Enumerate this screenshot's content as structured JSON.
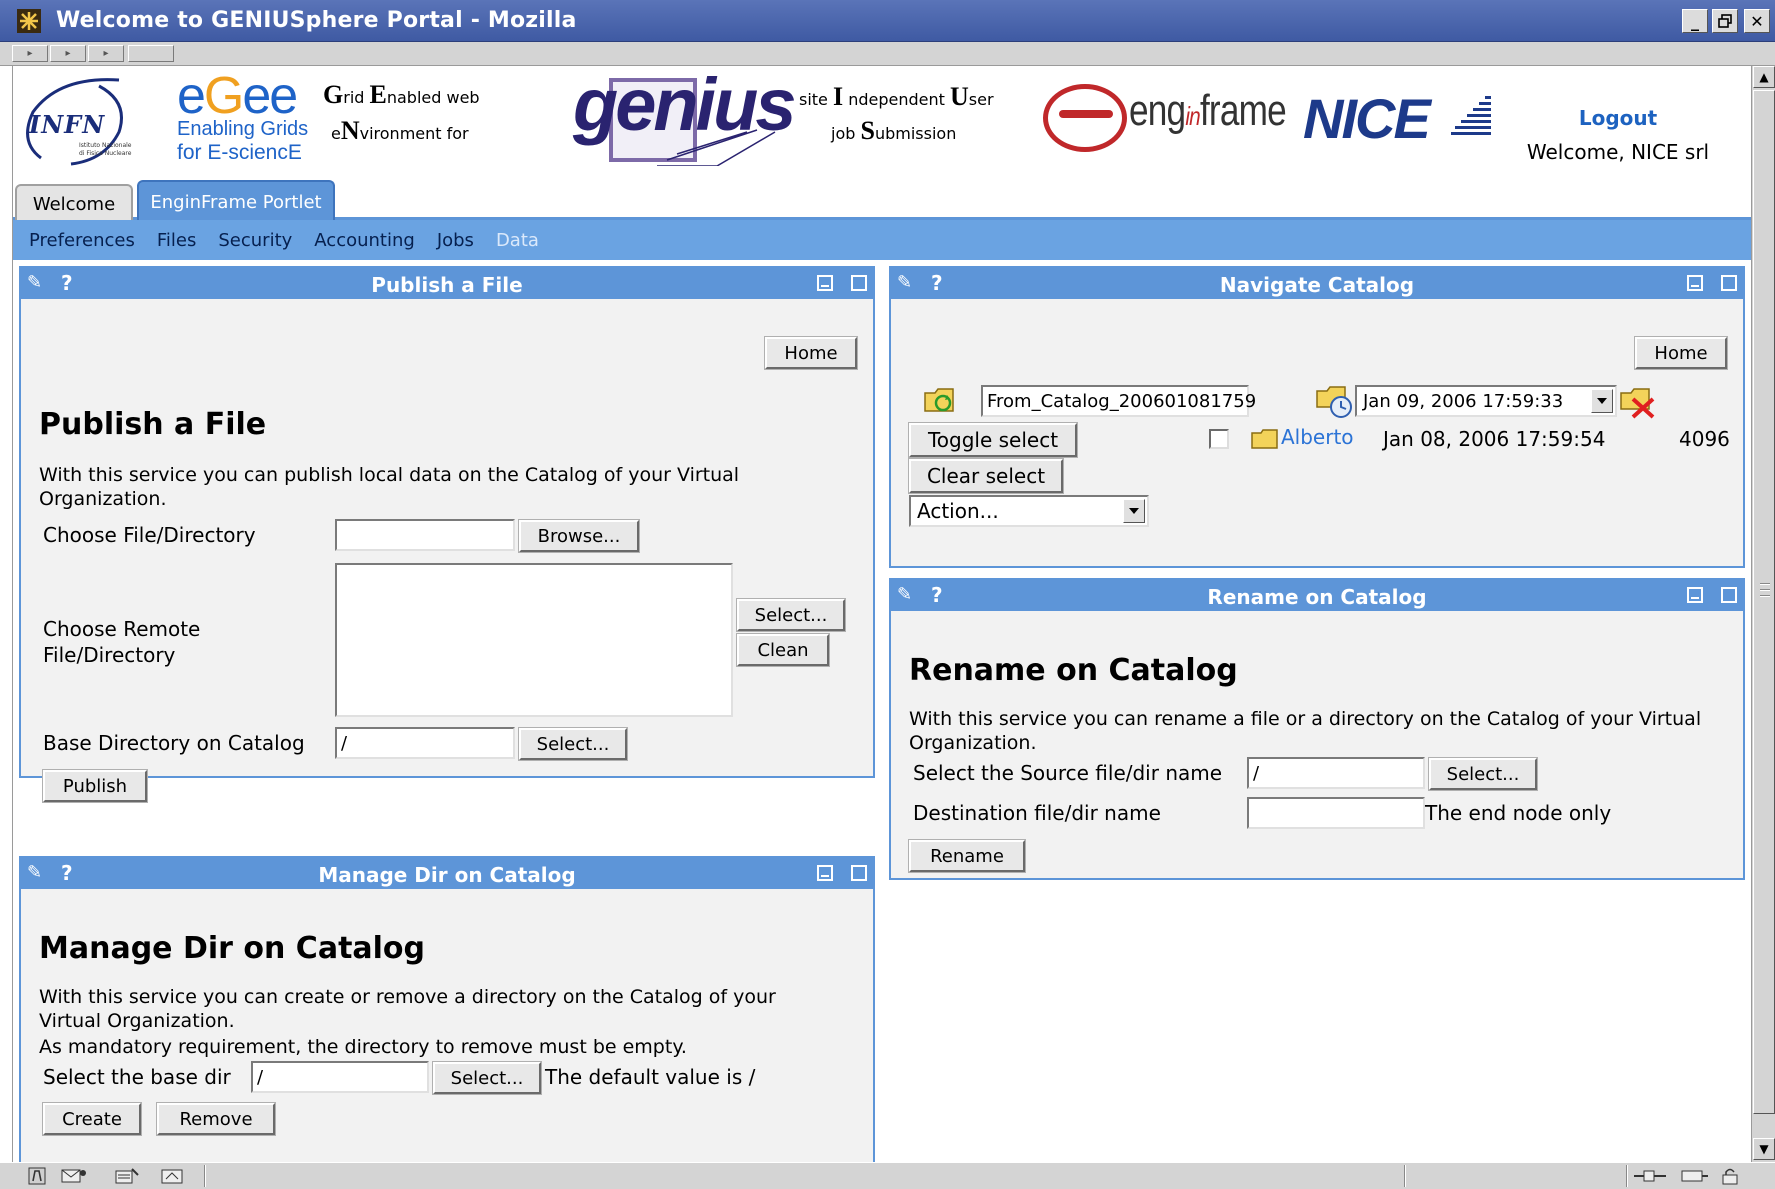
{
  "window": {
    "title": "Welcome to GENIUSphere Portal - Mozilla",
    "controls": {
      "minimize": "_",
      "restore": "▫",
      "close": "✕"
    }
  },
  "header": {
    "infn": {
      "name": "INFN",
      "line1": "Istituto Nazionale",
      "line2": "di Fisica Nucleare"
    },
    "egee": {
      "logo": "egee",
      "line1": "Enabling Grids",
      "line2": "for E-sciencE"
    },
    "genius_tagline_left": {
      "w1_big": "G",
      "w1": "rid ",
      "w2_big": "E",
      "w2": "nabled web",
      "w3": "e",
      "w3_big": "N",
      "w4": "vironment for"
    },
    "genius_logo": "genius",
    "genius_tagline_right": {
      "w1": "site ",
      "w2_big": "I",
      "w2": " ndependent ",
      "w3_big": "U",
      "w3": "ser",
      "w4": "job ",
      "w5_big": "S",
      "w5": "ubmission"
    },
    "enginframe_logo": {
      "a": "eng",
      "b": "in",
      "c": "frame"
    },
    "nice_logo": "NICE",
    "logout": "Logout",
    "welcome": "Welcome, NICE srl"
  },
  "tabs": [
    {
      "label": "Welcome"
    },
    {
      "label": "EnginFrame Portlet"
    }
  ],
  "subnav": [
    {
      "label": "Preferences"
    },
    {
      "label": "Files"
    },
    {
      "label": "Security"
    },
    {
      "label": "Accounting"
    },
    {
      "label": "Jobs"
    },
    {
      "label": "Data"
    }
  ],
  "publish": {
    "header": "Publish a File",
    "help": "?",
    "home": "Home",
    "title": "Publish a File",
    "description": "With this service you can publish local data on the Catalog of your Virtual Organization.",
    "choose_file_label": "Choose File/Directory",
    "browse": "Browse...",
    "choose_remote_label_1": "Choose Remote",
    "choose_remote_label_2": "File/Directory",
    "select": "Select...",
    "clean": "Clean",
    "base_dir_label": "Base Directory on Catalog",
    "base_dir_value": "/",
    "base_select": "Select...",
    "publish": "Publish"
  },
  "manage": {
    "header": "Manage Dir on Catalog",
    "help": "?",
    "title": "Manage Dir on Catalog",
    "description_1": "With this service you can create or remove a directory on the Catalog of your Virtual Organization.",
    "description_2": "As mandatory requirement, the directory to remove must be empty.",
    "base_dir_label": "Select the base dir",
    "base_dir_value": "/",
    "select": "Select...",
    "default_note": "The default value is /",
    "create": "Create",
    "remove": "Remove"
  },
  "navigate": {
    "header": "Navigate Catalog",
    "help": "?",
    "home": "Home",
    "catalog_name": "From_Catalog_200601081759",
    "date_value": "Jan 09, 2006 17:59:33",
    "toggle_select": "Toggle select",
    "clear_select": "Clear select",
    "action": "Action...",
    "row": {
      "name": "Alberto",
      "date": "Jan 08, 2006 17:59:54",
      "size": "4096"
    }
  },
  "rename": {
    "header": "Rename on Catalog",
    "help": "?",
    "title": "Rename on Catalog",
    "description": "With this service you can rename a file or a directory on the Catalog of your Virtual Organization.",
    "source_label": "Select the Source file/dir name",
    "source_value": "/",
    "select": "Select...",
    "dest_label": "Destination file/dir name",
    "dest_value": "",
    "dest_note": "The end node only",
    "rename": "Rename"
  },
  "statusbar": {
    "icons": [
      "mozilla-icon",
      "mail-icon",
      "composer-icon",
      "addressbook-icon"
    ]
  },
  "colors": {
    "portlet_header": "#5d95d8",
    "subnav": "#6aa3e2",
    "titlebar": "#4a64ac",
    "link": "#2b73d6"
  }
}
